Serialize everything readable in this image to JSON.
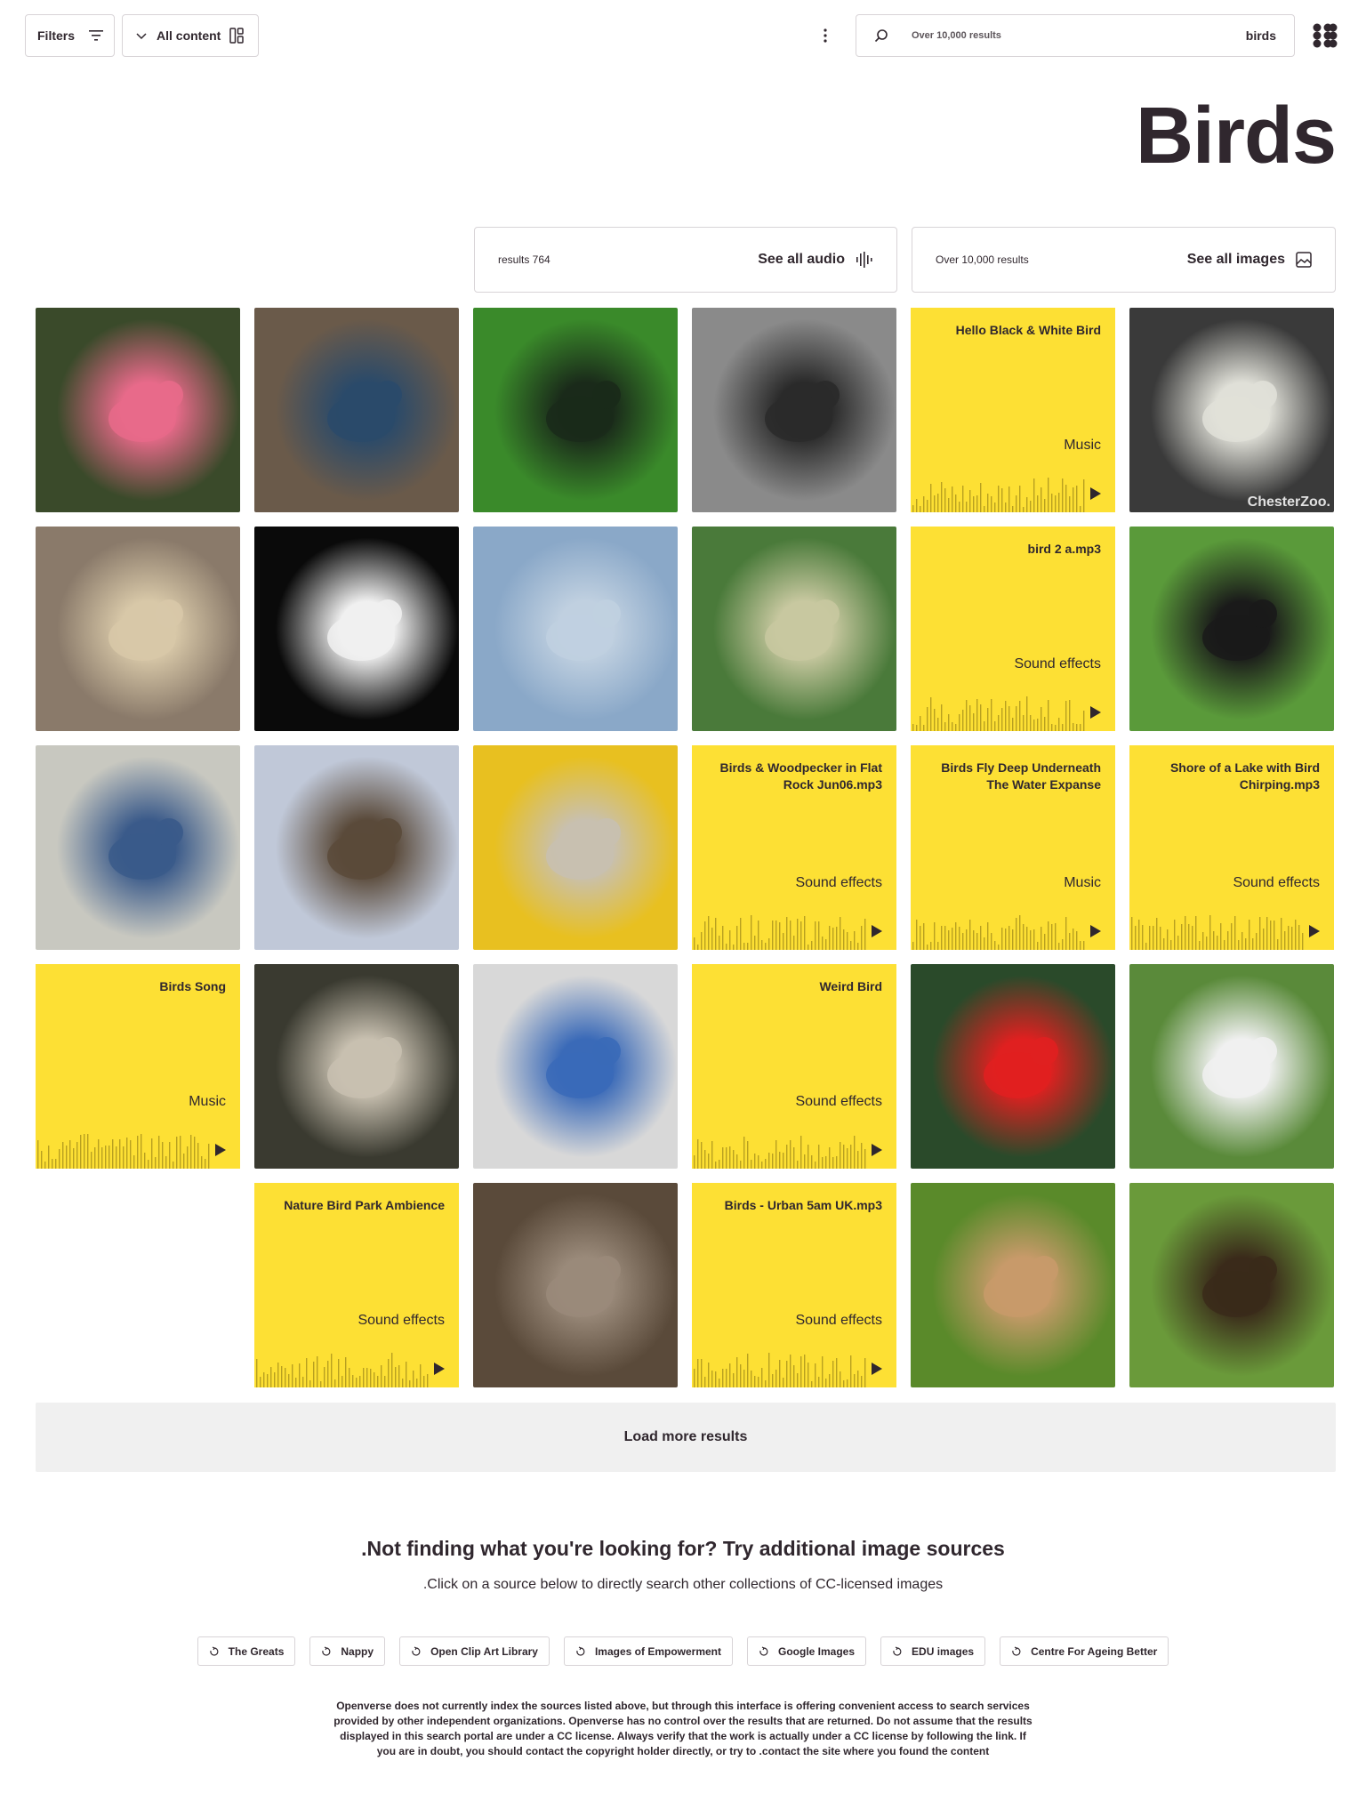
{
  "header": {
    "filters_label": "Filters",
    "content_type_label": "All content",
    "search": {
      "result_count": "Over 10,000 results",
      "term": "birds"
    }
  },
  "page": {
    "title": "Birds"
  },
  "collections": {
    "audio": {
      "count": "results 764",
      "label": "See all audio",
      "icon": "audio-waveform-icon"
    },
    "images": {
      "count": "Over 10,000 results",
      "label": "See all images",
      "icon": "image-icon"
    }
  },
  "tiles": [
    {
      "type": "image",
      "subject": "roseate spoonbill",
      "palette": [
        "#3a4a2a",
        "#e86a8a"
      ]
    },
    {
      "type": "image",
      "subject": "geese",
      "palette": [
        "#6a5a4a",
        "#2a4a6a"
      ]
    },
    {
      "type": "image",
      "subject": "starling",
      "palette": [
        "#3a8a2a",
        "#1a2a1a"
      ]
    },
    {
      "type": "image",
      "subject": "sparrows",
      "palette": [
        "#8a8a8a",
        "#2a2a2a"
      ]
    },
    {
      "type": "audio",
      "title": "Hello Black & White Bird",
      "category": "Music"
    },
    {
      "type": "image",
      "subject": "white pigeon",
      "palette": [
        "#3a3a3a",
        "#e0e0d8"
      ],
      "watermark": "ChesterZoo."
    },
    {
      "type": "image",
      "subject": "falcon",
      "palette": [
        "#8a7a6a",
        "#d8c8a8"
      ]
    },
    {
      "type": "image",
      "subject": "cockatiel",
      "palette": [
        "#0a0a0a",
        "#f0f0f0"
      ]
    },
    {
      "type": "image",
      "subject": "bird on wire",
      "palette": [
        "#8aa8c8",
        "#c0d0e0"
      ]
    },
    {
      "type": "image",
      "subject": "bird in branches",
      "palette": [
        "#4a7a3a",
        "#c8c8a0"
      ]
    },
    {
      "type": "audio",
      "title": "bird 2 a.mp3",
      "category": "Sound effects"
    },
    {
      "type": "image",
      "subject": "starling",
      "palette": [
        "#5a9a3a",
        "#1a1a1a"
      ]
    },
    {
      "type": "image",
      "subject": "scrub jay",
      "palette": [
        "#c8c8c0",
        "#3a5a8a"
      ]
    },
    {
      "type": "image",
      "subject": "thrush",
      "palette": [
        "#c0c8d8",
        "#5a4a3a"
      ]
    },
    {
      "type": "image",
      "subject": "falcon close-up",
      "palette": [
        "#e8c020",
        "#c8c0b0"
      ]
    },
    {
      "type": "audio",
      "title": "Birds & Woodpecker in Flat Rock Jun06.mp3",
      "category": "Sound effects"
    },
    {
      "type": "audio",
      "title": "Birds Fly Deep Underneath The Water Expanse",
      "category": "Music"
    },
    {
      "type": "audio",
      "title": "Shore of a Lake with Bird Chirping.mp3",
      "category": "Sound effects"
    },
    {
      "type": "audio",
      "title": "Birds Song",
      "category": "Music"
    },
    {
      "type": "image",
      "subject": "mockingbird",
      "palette": [
        "#3a3a30",
        "#c8c0b0"
      ]
    },
    {
      "type": "image",
      "subject": "bluebird",
      "palette": [
        "#d8d8d8",
        "#3a6ab8"
      ]
    },
    {
      "type": "audio",
      "title": "Weird Bird",
      "category": "Sound effects"
    },
    {
      "type": "image",
      "subject": "hummingbird",
      "palette": [
        "#2a4a2a",
        "#e02020"
      ]
    },
    {
      "type": "image",
      "subject": "flycatcher",
      "palette": [
        "#5a8a3a",
        "#f0f0f0"
      ]
    },
    {
      "type": "audio",
      "title": "Nature Bird Park Ambience",
      "category": "Sound effects"
    },
    {
      "type": "image",
      "subject": "ostrich",
      "palette": [
        "#5a4a3a",
        "#9a8a7a"
      ]
    },
    {
      "type": "audio",
      "title": "Birds - Urban 5am UK.mp3",
      "category": "Sound effects"
    },
    {
      "type": "image",
      "subject": "waxbills",
      "palette": [
        "#5a8a2a",
        "#c89a6a"
      ]
    },
    {
      "type": "image",
      "subject": "hermit hummingbird",
      "palette": [
        "#6a9a3a",
        "#3a2a1a"
      ]
    }
  ],
  "load_more_label": "Load more results",
  "external_sources": {
    "title": ".Not finding what you're looking for? Try additional image sources",
    "subtitle": ".Click on a source below to directly search other collections of CC-licensed images",
    "sources": [
      "The Greats",
      "Nappy",
      "Open Clip Art Library",
      "Images of Empowerment",
      "Google Images",
      "EDU images",
      "Centre For Ageing Better"
    ],
    "disclaimer": "Openverse does not currently index the sources listed above, but through this interface is offering convenient access to search services provided by other independent organizations. Openverse has no control over the results that are returned. Do not assume that the results displayed in this search portal are under a CC license. Always verify that the work is actually under a CC license by following the link. If you are in doubt, you should contact the copyright holder directly, or try to .contact the site where you found the content"
  }
}
